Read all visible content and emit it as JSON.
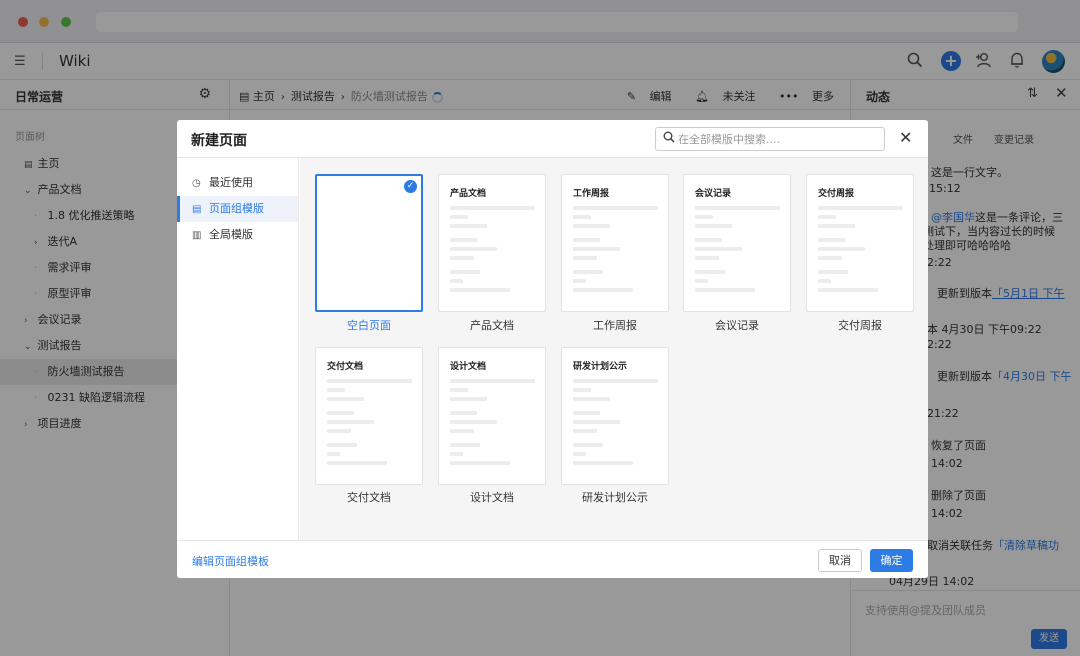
{
  "app": {
    "title": "Wiki"
  },
  "sidebar": {
    "space_name": "日常运营",
    "section_label": "页面树",
    "items": [
      {
        "label": "主页",
        "indent": 0
      },
      {
        "label": "产品文档",
        "indent": 1
      },
      {
        "label": "1.8 优化推送策略",
        "indent": 2
      },
      {
        "label": "迭代A",
        "indent": 2
      },
      {
        "label": "需求评审",
        "indent": 2
      },
      {
        "label": "原型评审",
        "indent": 2
      },
      {
        "label": "会议记录",
        "indent": 1
      },
      {
        "label": "测试报告",
        "indent": 1
      },
      {
        "label": "防火墙测试报告",
        "indent": 2
      },
      {
        "label": "0231 缺陷逻辑流程",
        "indent": 2
      },
      {
        "label": "项目进度",
        "indent": 1
      }
    ]
  },
  "main": {
    "breadcrumb": [
      "主页",
      "测试报告",
      "防火墙测试报告"
    ],
    "actions": {
      "edit": "编辑",
      "follow": "未关注",
      "more": "更多"
    }
  },
  "activity": {
    "title": "动态",
    "tabs": [
      "文件",
      "变更记录"
    ],
    "entries": [
      {
        "text": "这是一行文字。",
        "time": "15:12"
      },
      {
        "text_mention": "@李国华",
        "text": "这是一条评论，三",
        "text2": "测试下，当内容过长的时候",
        "text3": "处理即可哈哈哈哈",
        "time": "2:22"
      },
      {
        "text": "更新到版本",
        "link": "「5月1日 下午",
        "time": ""
      },
      {
        "text": "本 4月30日 下午09:22",
        "time": "2:22"
      },
      {
        "text": "更新到版本",
        "link": "「4月30日 下午",
        "time": "21:22"
      },
      {
        "text": "恢复了页面",
        "time": "14:02"
      },
      {
        "text": "删除了页面",
        "time": "14:02"
      },
      {
        "text": "取消关联任务",
        "link": "「清除草稿功",
        "time": "04月29日 14:02"
      }
    ],
    "comment_placeholder": "支持使用@提及团队成员",
    "send_label": "发送"
  },
  "modal": {
    "title": "新建页面",
    "search_placeholder": "在全部模版中搜索....",
    "nav": [
      {
        "label": "最近使用",
        "icon": "clock-icon"
      },
      {
        "label": "页面组模版",
        "icon": "page-group-icon"
      },
      {
        "label": "全局模版",
        "icon": "grid-icon"
      }
    ],
    "active_nav": 1,
    "templates": [
      {
        "name": "空白页面",
        "card_title": "",
        "selected": true
      },
      {
        "name": "产品文档",
        "card_title": "产品文档",
        "selected": false
      },
      {
        "name": "工作周报",
        "card_title": "工作周报",
        "selected": false
      },
      {
        "name": "会议记录",
        "card_title": "会议记录",
        "selected": false
      },
      {
        "name": "交付周报",
        "card_title": "交付周报",
        "selected": false
      },
      {
        "name": "交付文档",
        "card_title": "交付文档",
        "selected": false
      },
      {
        "name": "设计文档",
        "card_title": "设计文档",
        "selected": false
      },
      {
        "name": "研发计划公示",
        "card_title": "研发计划公示",
        "selected": false
      }
    ],
    "footer": {
      "edit_link": "编辑页面组模板",
      "cancel": "取消",
      "confirm": "确定"
    }
  },
  "colors": {
    "accent": "#2d7be5",
    "overlay": "rgba(0,0,0,0.4)"
  }
}
